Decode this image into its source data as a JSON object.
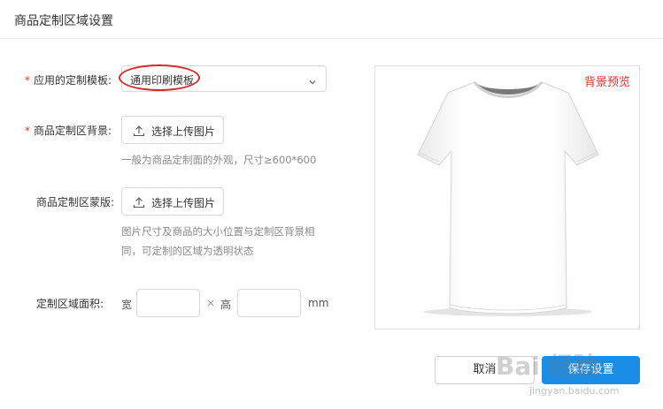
{
  "dialog": {
    "title": "商品定制区域设置"
  },
  "form": {
    "template": {
      "label": "应用的定制模板:",
      "value": "通用印刷模板"
    },
    "background": {
      "label": "商品定制区背景:",
      "button": "选择上传图片",
      "hint": "一般为商品定制面的外观，尺寸≥600*600"
    },
    "mask": {
      "label": "商品定制区蒙版:",
      "button": "选择上传图片",
      "hint_line1": "图片尺寸及商品的大小位置与定制区背景相",
      "hint_line2": "同，可定制的区域为透明状态"
    },
    "area": {
      "label": "定制区域面积:",
      "width_label": "宽",
      "times": "×",
      "height_label": "高",
      "unit": "mm",
      "width_value": "",
      "height_value": ""
    },
    "required_mark": "*"
  },
  "preview": {
    "label": "背景预览"
  },
  "buttons": {
    "cancel": "取消",
    "save": "保存设置"
  },
  "watermark": {
    "main": "Bai 经验",
    "sub": "jingyan.baidu.com"
  },
  "colors": {
    "accent": "#1a8ee6",
    "required": "#e0322d",
    "highlight": "#d8282c"
  }
}
